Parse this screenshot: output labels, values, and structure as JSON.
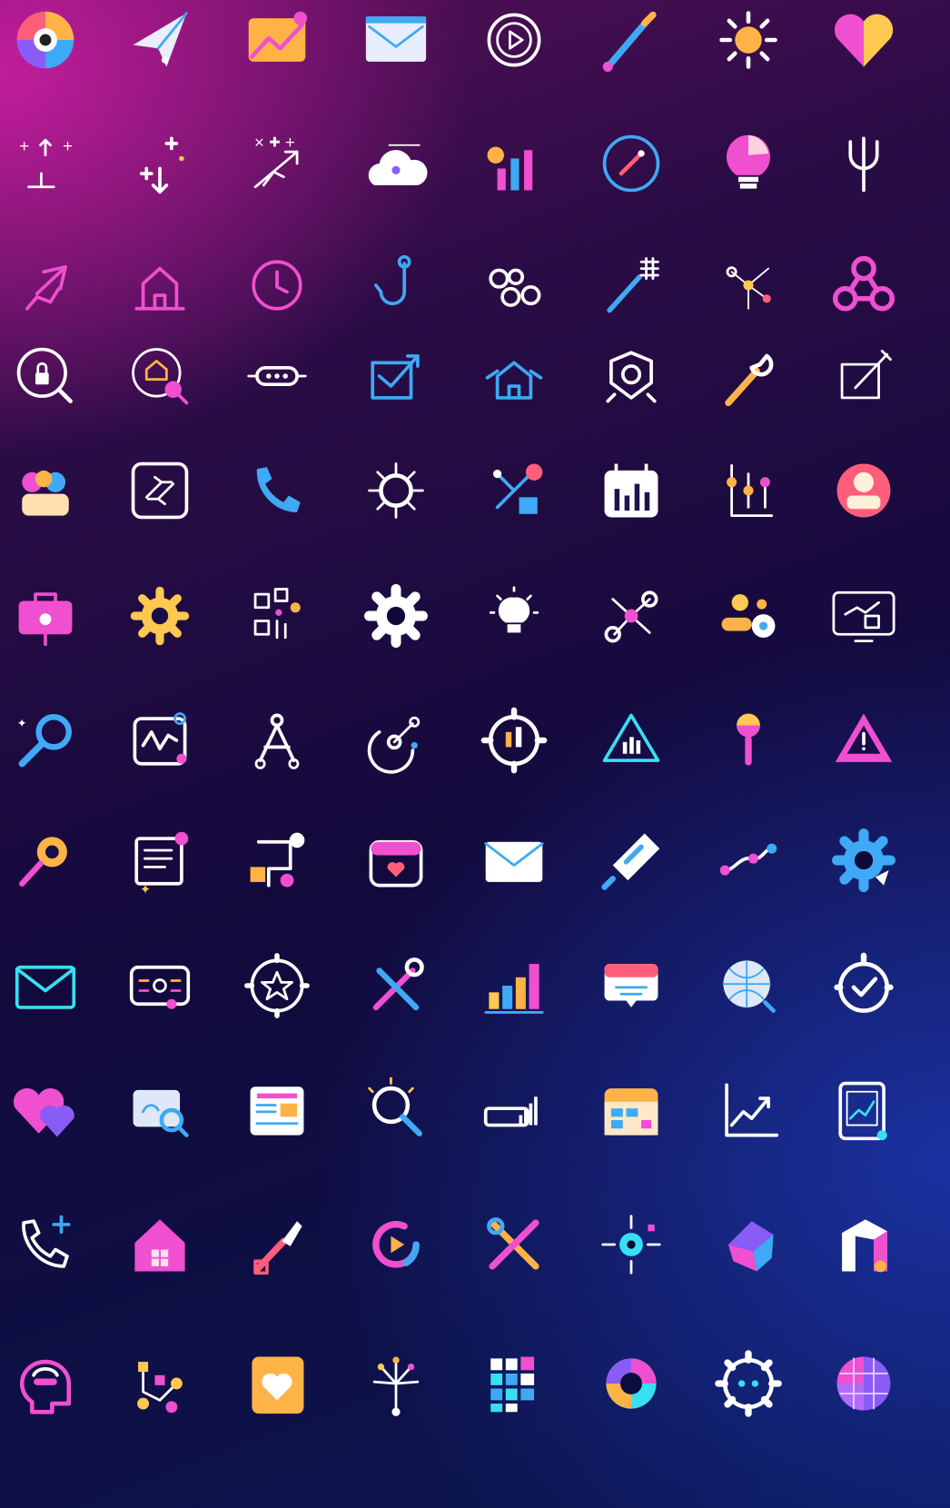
{
  "icon_grid": {
    "columns": 8,
    "rows": 12,
    "icons": [
      "color-wheel-icon",
      "paper-plane-icon",
      "image-chart-icon",
      "browser-mail-icon",
      "play-gear-icon",
      "paintbrush-icon",
      "sun-icon",
      "heart-icon",
      "move-arrows-icon",
      "plus-arrow-icon",
      "diagonal-arrow-icon",
      "cloud-user-icon",
      "bar-chart-icon",
      "compass-icon",
      "lightbulb-icon",
      "fork-icon",
      "arrow-up-right-icon",
      "home-outline-icon",
      "clock-icon",
      "hook-icon",
      "link-chain-icon",
      "magic-wand-icon",
      "network-nodes-icon",
      "fidget-spinner-icon",
      "lock-search-icon",
      "search-home-icon",
      "more-dots-icon",
      "check-box-icon",
      "house-arrows-icon",
      "badge-icon",
      "wrench-hammer-icon",
      "edit-square-icon",
      "team-people-icon",
      "transfer-frame-icon",
      "phone-icon",
      "molecule-icon",
      "network-home-icon",
      "calendar-chart-icon",
      "flowchart-icon",
      "avatar-badge-icon",
      "briefcase-icon",
      "gear-icon",
      "qr-code-icon",
      "gear-white-icon",
      "idea-bulb-icon",
      "share-gears-icon",
      "toggle-settings-icon",
      "monitor-chart-icon",
      "magnifier-icon",
      "analytics-board-icon",
      "compass-tool-icon",
      "target-arrow-icon",
      "gear-chart-icon",
      "triangle-chart-icon",
      "pin-drop-icon",
      "recycle-warning-icon",
      "rocket-search-icon",
      "document-list-icon",
      "process-flow-icon",
      "calendar-heart-icon",
      "envelope-icon",
      "rocket-ticket-icon",
      "route-icon",
      "settings-gear-icon",
      "mail-icon",
      "id-card-icon",
      "star-badge-icon",
      "tools-icon",
      "bar-graph-icon",
      "chat-window-icon",
      "globe-search-icon",
      "timer-check-icon",
      "hearts-icon",
      "link-search-icon",
      "newspaper-icon",
      "search-icon",
      "signal-bars-icon",
      "calendar-icon",
      "growth-chart-icon",
      "tablet-chart-icon",
      "phone-add-icon",
      "house-icon",
      "wrench-rocket-icon",
      "replay-icon",
      "tools-cross-icon",
      "gear-network-icon",
      "cube-shape-icon",
      "door-shape-icon",
      "brain-head-icon",
      "node-network-icon",
      "heart-card-icon",
      "fireworks-icon",
      "grid-blocks-icon",
      "donut-gear-icon",
      "robot-gear-icon",
      "gem-sphere-icon"
    ]
  }
}
